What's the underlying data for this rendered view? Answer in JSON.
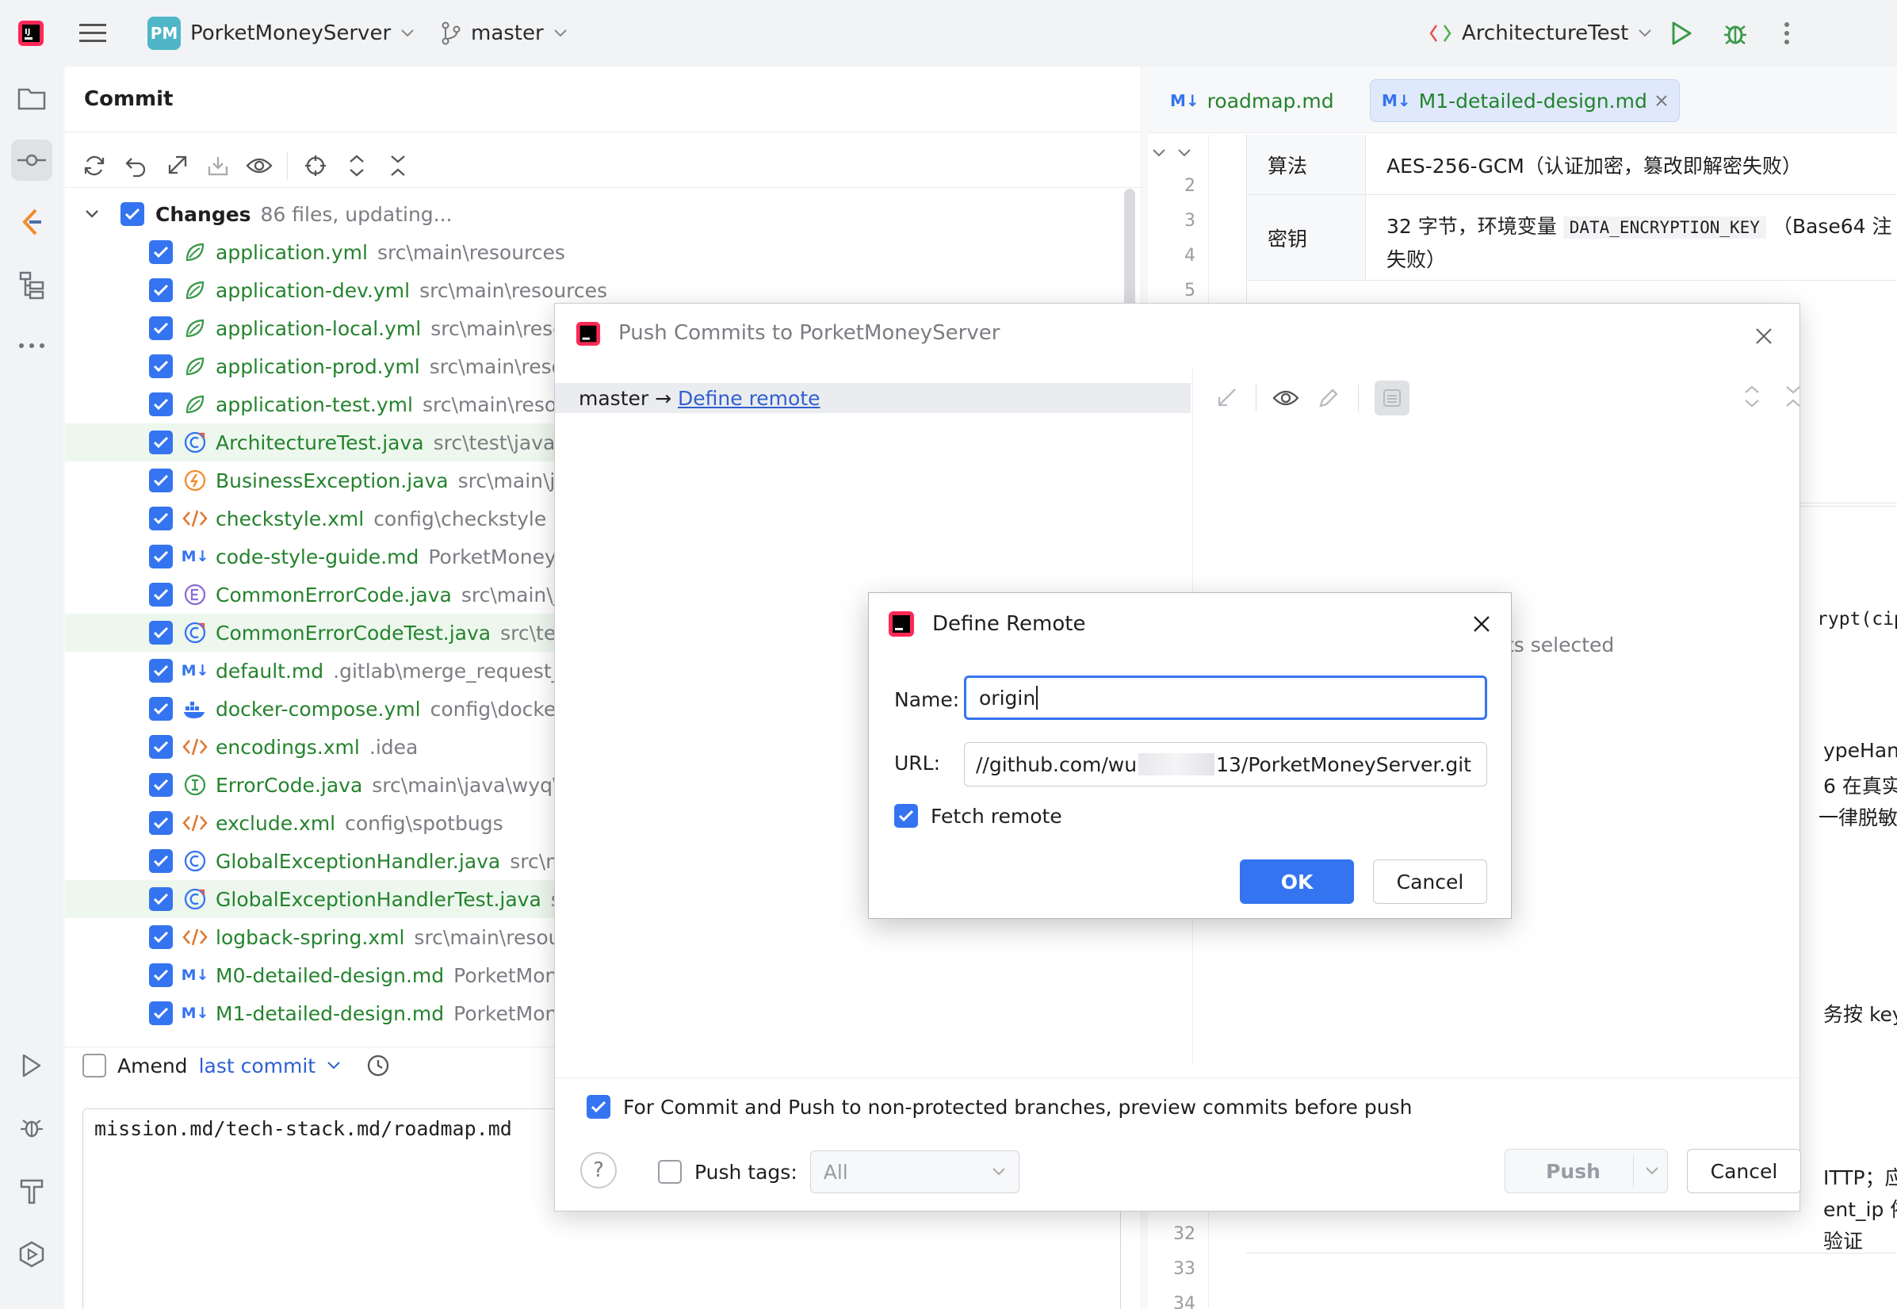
{
  "topbar": {
    "project_badge": "PM",
    "project_name": "PorketMoneyServer",
    "branch": "master",
    "run_config": "ArchitectureTest"
  },
  "commit_panel": {
    "title": "Commit",
    "changes_label": "Changes",
    "changes_count": "86 files, updating...",
    "files": [
      {
        "name": "application.yml",
        "path": "src\\main\\resources",
        "icon": "spring-icon"
      },
      {
        "name": "application-dev.yml",
        "path": "src\\main\\resources",
        "icon": "spring-icon"
      },
      {
        "name": "application-local.yml",
        "path": "src\\main\\resour",
        "icon": "spring-icon"
      },
      {
        "name": "application-prod.yml",
        "path": "src\\main\\resour",
        "icon": "spring-icon"
      },
      {
        "name": "application-test.yml",
        "path": "src\\main\\resourc",
        "icon": "spring-icon"
      },
      {
        "name": "ArchitectureTest.java",
        "path": "src\\test\\java\\wy",
        "icon": "test-class-icon"
      },
      {
        "name": "BusinessException.java",
        "path": "src\\main\\java\\",
        "icon": "exception-icon"
      },
      {
        "name": "checkstyle.xml",
        "path": "config\\checkstyle",
        "icon": "xml-icon"
      },
      {
        "name": "code-style-guide.md",
        "path": "PorketMoneySe",
        "icon": "markdown-icon"
      },
      {
        "name": "CommonErrorCode.java",
        "path": "src\\main\\java",
        "icon": "enum-icon"
      },
      {
        "name": "CommonErrorCodeTest.java",
        "path": "src\\test\\",
        "icon": "test-class-icon"
      },
      {
        "name": "default.md",
        "path": ".gitlab\\merge_request_te",
        "icon": "markdown-icon"
      },
      {
        "name": "docker-compose.yml",
        "path": "config\\docker",
        "icon": "docker-icon"
      },
      {
        "name": "encodings.xml",
        "path": ".idea",
        "icon": "xml-icon"
      },
      {
        "name": "ErrorCode.java",
        "path": "src\\main\\java\\wyq\\po",
        "icon": "interface-icon"
      },
      {
        "name": "exclude.xml",
        "path": "config\\spotbugs",
        "icon": "xml-icon"
      },
      {
        "name": "GlobalExceptionHandler.java",
        "path": "src\\main",
        "icon": "class-icon"
      },
      {
        "name": "GlobalExceptionHandlerTest.java",
        "path": "src\\",
        "icon": "test-class-icon"
      },
      {
        "name": "logback-spring.xml",
        "path": "src\\main\\resource",
        "icon": "xml-icon"
      },
      {
        "name": "M0-detailed-design.md",
        "path": "PorketMoney",
        "icon": "markdown-icon"
      },
      {
        "name": "M1-detailed-design.md",
        "path": "PorketMoney",
        "icon": "markdown-icon"
      }
    ],
    "amend_label": "Amend",
    "amend_link": "last commit",
    "message": "mission.md/tech-stack.md/roadmap.md"
  },
  "editor": {
    "tabs": [
      {
        "label": "roadmap.md",
        "icon": "M↓"
      },
      {
        "label": "M1-detailed-design.md",
        "icon": "M↓"
      }
    ],
    "gutter_top": [
      "2",
      "3",
      "4",
      "5"
    ],
    "gutter_bottom": [
      "32",
      "33",
      "34"
    ],
    "table": {
      "row1_key": "算法",
      "row1_val": "AES-256-GCM（认证加密，篡改即解密失败）",
      "row2_key": "密钥",
      "row2_val_a": "32 字节，环境变量",
      "row2_code": "DATA_ENCRYPTION_KEY",
      "row2_val_b": "（Base64 注",
      "row2_val_c": "失败）"
    },
    "fragments": {
      "ypt": "rypt(cip",
      "typehand": "ypeHand",
      "real": "6 在真实",
      "mask": "一律脱敏",
      "key": "务按 key",
      "http": "ITTP；应",
      "entip": "ent_ip 依",
      "verify": "验证"
    }
  },
  "push_dialog": {
    "title": "Push Commits to PorketMoneyServer",
    "branch_label": "master →",
    "define_remote_link": "Define remote",
    "no_commits_fragment": "ts selected",
    "preview_option": "For Commit and Push to non-protected branches, preview commits before push",
    "push_tags_label": "Push tags:",
    "push_tags_value": "All",
    "push_button": "Push",
    "cancel_button": "Cancel",
    "help": "?"
  },
  "define_remote": {
    "title": "Define Remote",
    "name_label": "Name:",
    "name_value": "origin",
    "url_label": "URL:",
    "url_prefix": "//github.com/wu",
    "url_suffix": "13/PorketMoneyServer.git",
    "fetch_label": "Fetch remote",
    "ok_button": "OK",
    "cancel_button": "Cancel"
  },
  "colors": {
    "accent": "#3574f0",
    "vcs_added": "#24832d",
    "changed_row_bg": "#edf7ee"
  }
}
